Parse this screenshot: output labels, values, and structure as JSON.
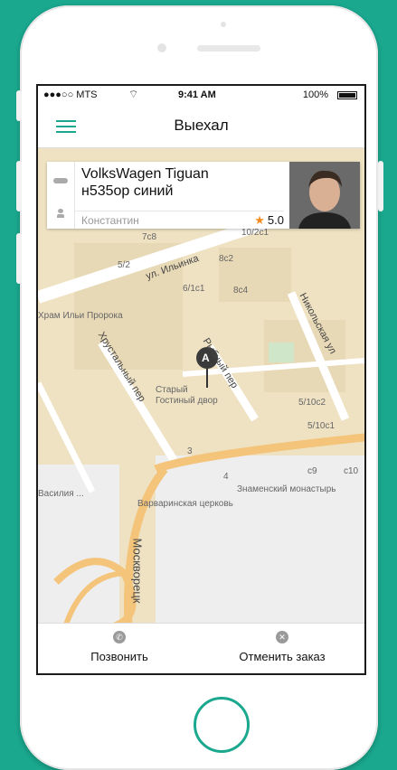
{
  "status_bar": {
    "carrier": "●●●○○ MTS",
    "time": "9:41 AM",
    "battery": "100%"
  },
  "header": {
    "title": "Выехал"
  },
  "driver_card": {
    "car_model": "VolksWagen Tiguan",
    "car_plate_color": "н535ор синий",
    "driver_name": "Константин",
    "rating": "5.0"
  },
  "map": {
    "streets": [
      "ул. Ильинка",
      "Хрустальный пер",
      "Рыбный пер",
      "Никольская ул",
      "Москворецк"
    ],
    "places": [
      "Старый Гостиный двор",
      "Варваринская церковь",
      "Знаменский монастырь",
      "Храм Ильи Пророка",
      "Василия ..."
    ],
    "marker_label": "A",
    "house_labels": [
      "7/2",
      "10/2c1",
      "5/2",
      "6/1c1",
      "8c2",
      "8c4",
      "5/10c2",
      "5/10c1",
      "7c8",
      "3",
      "c10",
      "c9",
      "4"
    ]
  },
  "actions": {
    "call_label": "Позвонить",
    "cancel_label": "Отменить заказ"
  },
  "colors": {
    "accent": "#1aa88e",
    "star": "#f58a1f"
  }
}
